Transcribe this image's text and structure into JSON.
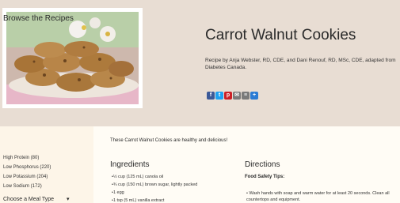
{
  "recipe": {
    "title": "Carrot Walnut Cookies",
    "byline": "Recipe by Anja Webster, RD, CDE, and Dani Renouf, RD, MSc, CDE, adapted from Diabetes Canada."
  },
  "share": [
    {
      "name": "facebook",
      "glyph": "f",
      "color": "#3b5998"
    },
    {
      "name": "twitter",
      "glyph": "t",
      "color": "#1da1f2"
    },
    {
      "name": "pinterest",
      "glyph": "p",
      "color": "#cb2027"
    },
    {
      "name": "email",
      "glyph": "✉",
      "color": "#7a7a7a"
    },
    {
      "name": "print",
      "glyph": "≡",
      "color": "#7a7a7a"
    },
    {
      "name": "more",
      "glyph": "+",
      "color": "#2a7bd4"
    }
  ],
  "sidebar": {
    "title": "Browse the Recipes",
    "items": [
      "High Protein (80)",
      "Low Phosphorus (220)",
      "Low Potassium (204)",
      "Low Sodium (172)"
    ],
    "select_label": "Choose a Meal Type",
    "select_chevron": "▾"
  },
  "main": {
    "intro": "These Carrot Walnut Cookies are healthy and delicious!",
    "ingredients_heading": "Ingredients",
    "ingredients": [
      "½ cup (125 mL) canola oil",
      "¾ cup (150 mL) brown sugar, lightly packed",
      "1 egg",
      "1 tsp (5 mL) vanilla extract"
    ],
    "directions_heading": "Directions",
    "food_safety": "Food Safety Tips:",
    "directions_steps": [
      "Wash hands with soap and warm water for at least 20 seconds. Clean all countertops and equipment."
    ]
  }
}
